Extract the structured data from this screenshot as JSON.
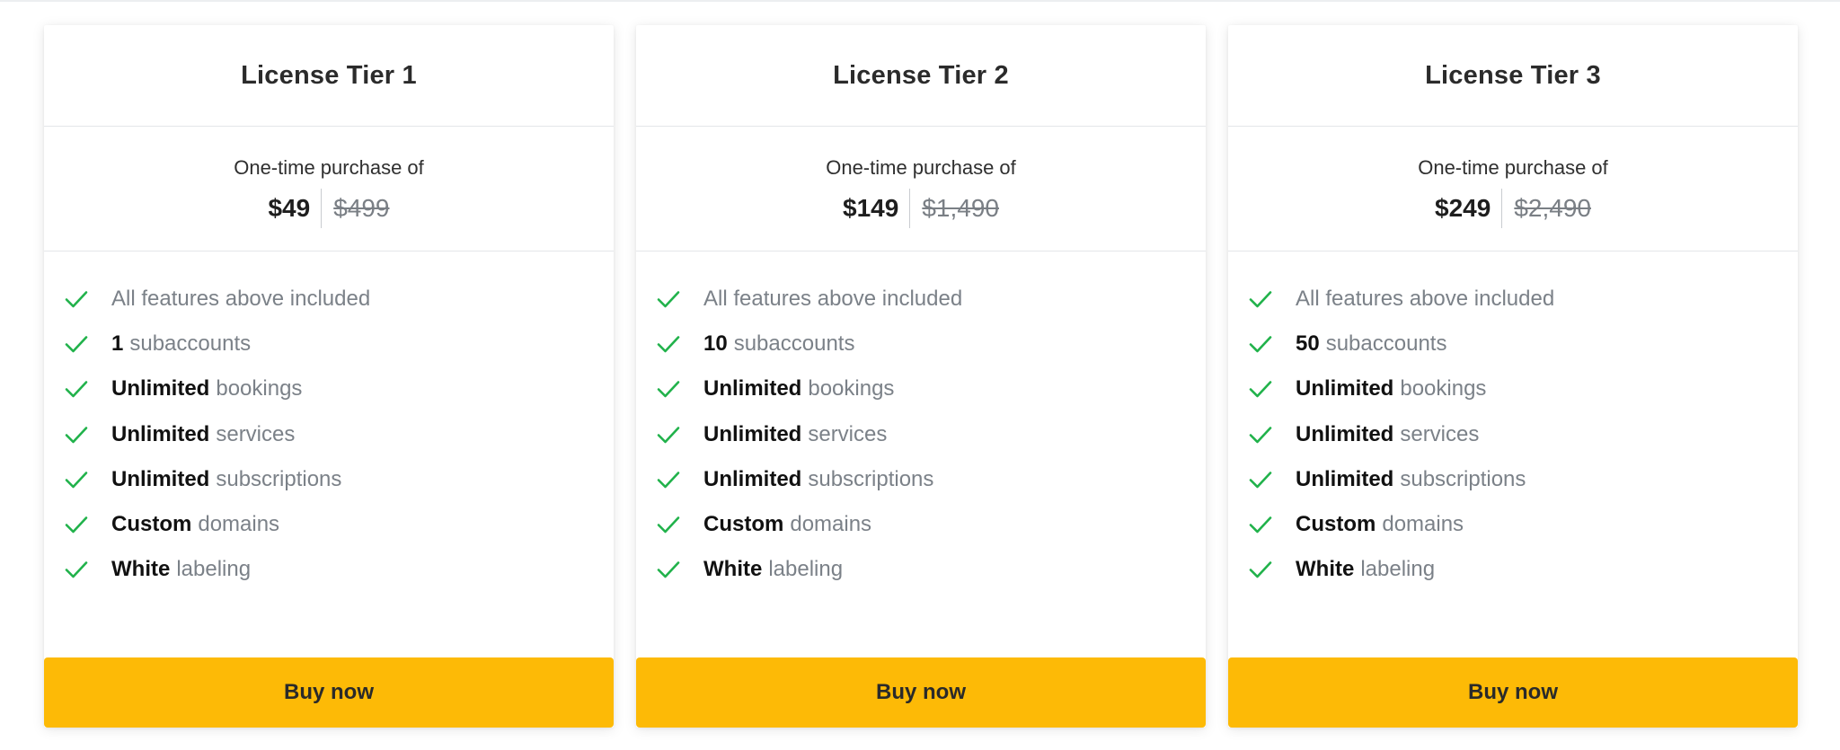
{
  "colors": {
    "accent": "#fdba06",
    "check": "#21b24b",
    "muted_text": "#7b8188"
  },
  "icons": {
    "feature_check": "check-icon"
  },
  "tiers": [
    {
      "title": "License Tier 1",
      "price_caption": "One-time purchase of",
      "price_now": "$49",
      "price_was": "$499",
      "features": [
        {
          "strong": "",
          "text": "All features above included"
        },
        {
          "strong": "1",
          "text": "subaccounts"
        },
        {
          "strong": "Unlimited",
          "text": "bookings"
        },
        {
          "strong": "Unlimited",
          "text": "services"
        },
        {
          "strong": "Unlimited",
          "text": "subscriptions"
        },
        {
          "strong": "Custom",
          "text": "domains"
        },
        {
          "strong": "White",
          "text": "labeling"
        }
      ],
      "button_label": "Buy now"
    },
    {
      "title": "License Tier 2",
      "price_caption": "One-time purchase of",
      "price_now": "$149",
      "price_was": "$1,490",
      "features": [
        {
          "strong": "",
          "text": "All features above included"
        },
        {
          "strong": "10",
          "text": "subaccounts"
        },
        {
          "strong": "Unlimited",
          "text": "bookings"
        },
        {
          "strong": "Unlimited",
          "text": "services"
        },
        {
          "strong": "Unlimited",
          "text": "subscriptions"
        },
        {
          "strong": "Custom",
          "text": "domains"
        },
        {
          "strong": "White",
          "text": "labeling"
        }
      ],
      "button_label": "Buy now"
    },
    {
      "title": "License Tier 3",
      "price_caption": "One-time purchase of",
      "price_now": "$249",
      "price_was": "$2,490",
      "features": [
        {
          "strong": "",
          "text": "All features above included"
        },
        {
          "strong": "50",
          "text": "subaccounts"
        },
        {
          "strong": "Unlimited",
          "text": "bookings"
        },
        {
          "strong": "Unlimited",
          "text": "services"
        },
        {
          "strong": "Unlimited",
          "text": "subscriptions"
        },
        {
          "strong": "Custom",
          "text": "domains"
        },
        {
          "strong": "White",
          "text": "labeling"
        }
      ],
      "button_label": "Buy now"
    }
  ]
}
